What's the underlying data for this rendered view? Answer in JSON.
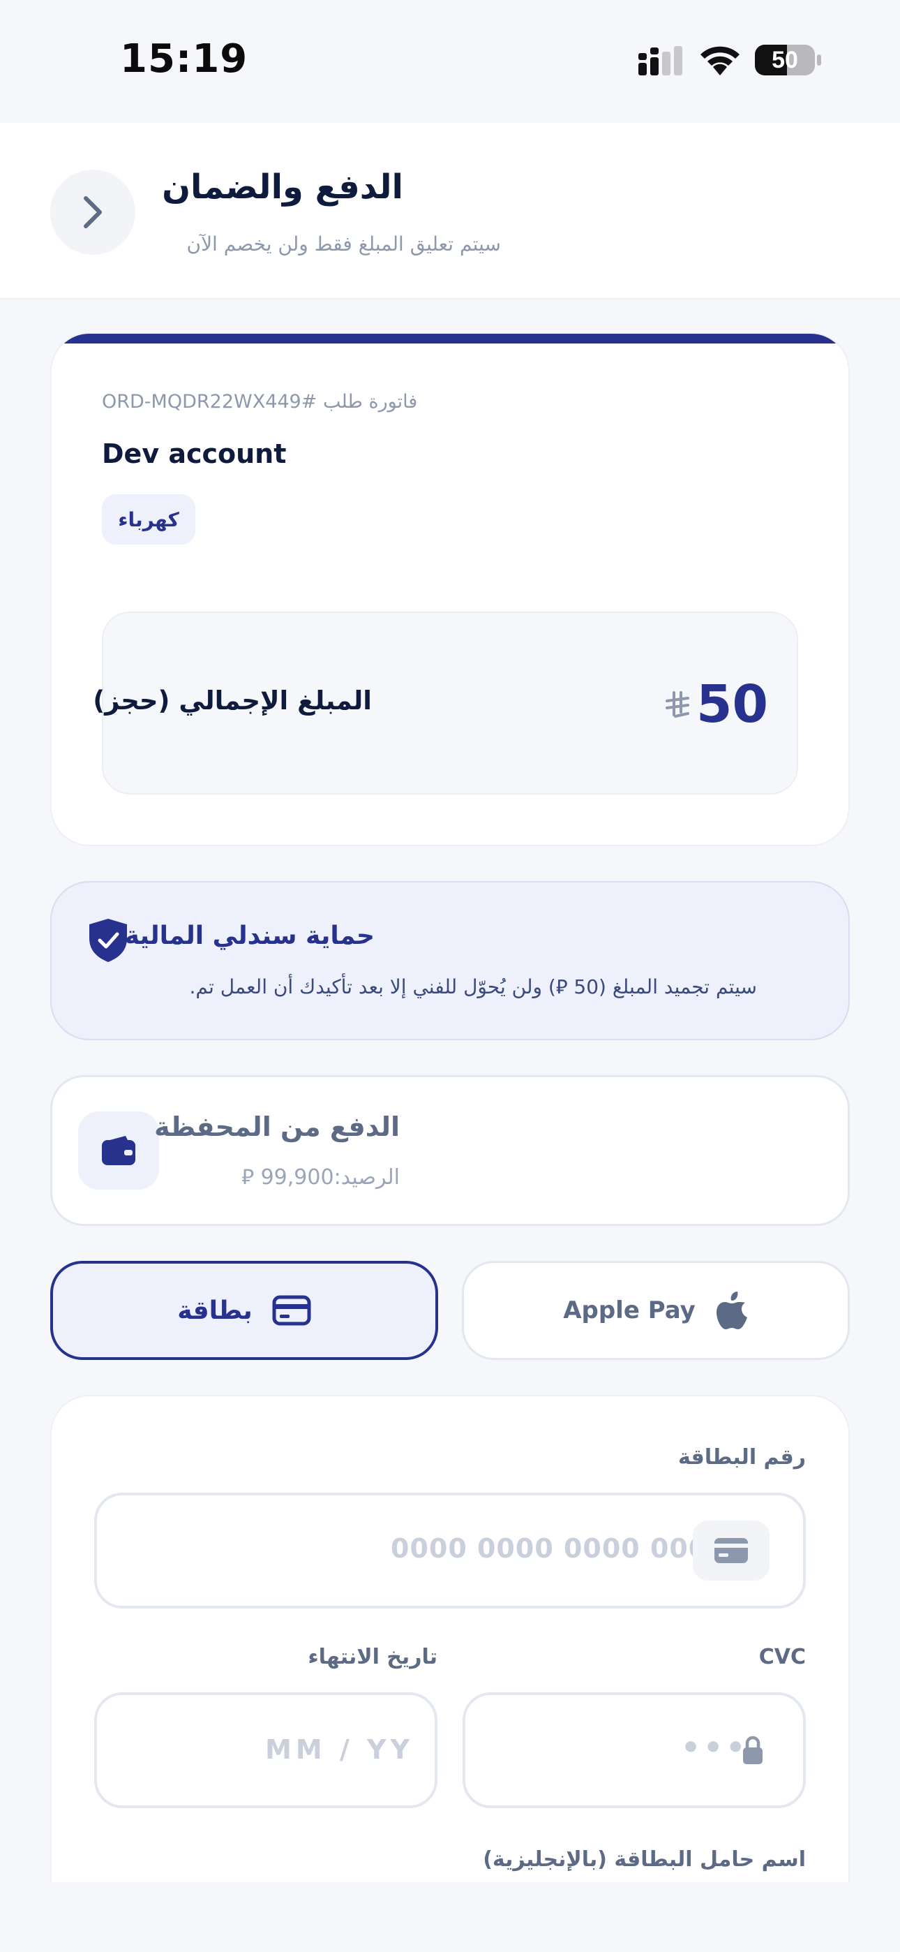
{
  "status_bar": {
    "time": "15:19",
    "battery": "50"
  },
  "header": {
    "title": "الدفع والضمان",
    "subtitle": "سيتم تعليق المبلغ فقط ولن يخصم الآن",
    "back_icon": "chevron-right-icon"
  },
  "invoice": {
    "number": "فاتورة طلب #ORD-MQDR22WX449",
    "account": "Dev account",
    "category": "كهرباء",
    "total_label": "المبلغ الإجمالي (حجز)",
    "total_value": "50",
    "currency_symbol": "⃁"
  },
  "protection": {
    "title": "حماية سندلي المالية",
    "text": "سيتم تجميد المبلغ (50 ⃁) ولن يُحوّل للفني إلا بعد تأكيدك أن العمل تم."
  },
  "wallet": {
    "title": "الدفع من المحفظة",
    "balance": "الرصيد:99,900 ⃁"
  },
  "methods": {
    "card_label": "بطاقة",
    "apple_label": "Apple Pay",
    "selected": "card"
  },
  "card_form": {
    "card_number_label": "رقم البطاقة",
    "card_number_placeholder": "0000 0000 0000 0000",
    "expiry_label": "تاريخ الانتهاء",
    "expiry_placeholder": "MM / YY",
    "cvc_label": "CVC",
    "cvc_placeholder": "•••",
    "holder_label": "اسم حامل البطاقة (بالإنجليزية)"
  },
  "colors": {
    "primary": "#26328e",
    "background": "#f6f7fa",
    "muted": "#8d98ad"
  }
}
